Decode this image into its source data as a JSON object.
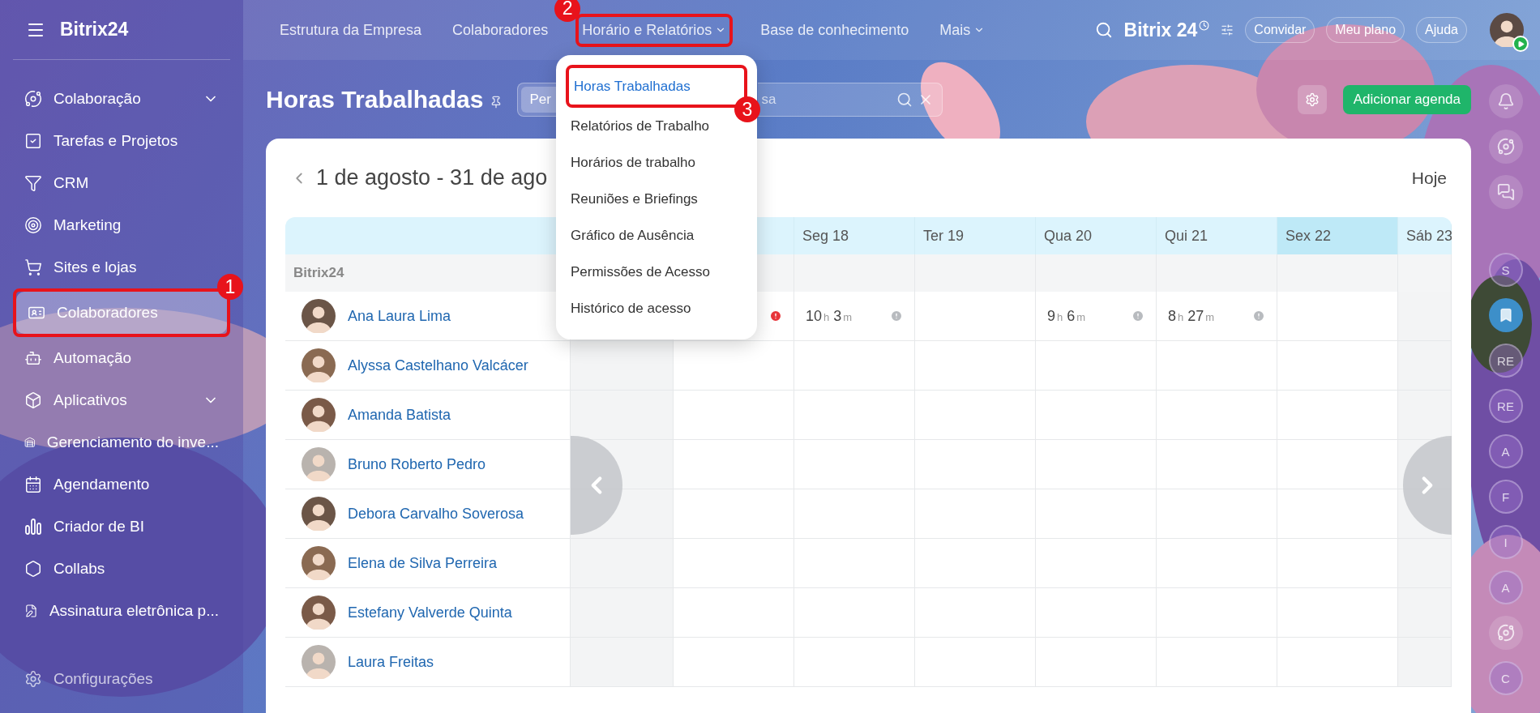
{
  "sidebar": {
    "logo": "Bitrix24",
    "items": [
      {
        "label": "Colaboração",
        "expandable": true,
        "selected": false
      },
      {
        "label": "Tarefas e Projetos",
        "expandable": false,
        "selected": false
      },
      {
        "label": "CRM",
        "expandable": false,
        "selected": false
      },
      {
        "label": "Marketing",
        "expandable": false,
        "selected": false
      },
      {
        "label": "Sites e lojas",
        "expandable": false,
        "selected": false
      },
      {
        "label": "Colaboradores",
        "expandable": false,
        "selected": true,
        "callout": "1"
      },
      {
        "label": "Automação",
        "expandable": false,
        "selected": false
      },
      {
        "label": "Aplicativos",
        "expandable": true,
        "selected": false
      },
      {
        "label": "Gerenciamento do inve...",
        "expandable": false,
        "selected": false
      },
      {
        "label": "Agendamento",
        "expandable": false,
        "selected": false
      },
      {
        "label": "Criador de BI",
        "expandable": false,
        "selected": false
      },
      {
        "label": "Collabs",
        "expandable": false,
        "selected": false
      },
      {
        "label": "Assinatura eletrônica p...",
        "expandable": false,
        "selected": false
      }
    ],
    "footer": "Configurações"
  },
  "topbar": {
    "nav": [
      {
        "label": "Estrutura da Empresa",
        "has_menu": false
      },
      {
        "label": "Colaboradores",
        "has_menu": false
      },
      {
        "label": "Horário e Relatórios",
        "has_menu": true,
        "callout": "2"
      },
      {
        "label": "Base de conhecimento",
        "has_menu": false
      },
      {
        "label": "Mais",
        "has_menu": true
      }
    ],
    "brand": "Bitrix 24",
    "buttons": [
      "Convidar",
      "Meu plano",
      "Ajuda"
    ]
  },
  "page": {
    "title": "Horas Trabalhadas",
    "filter_chip": "Per",
    "search_placeholder": "sa",
    "primary_button": "Adicionar agenda"
  },
  "dropdown": {
    "items": [
      {
        "label": "Horas Trabalhadas",
        "selected": true,
        "callout": "3"
      },
      {
        "label": "Relatórios de Trabalho",
        "selected": false
      },
      {
        "label": "Horários de trabalho",
        "selected": false
      },
      {
        "label": "Reuniões e Briefings",
        "selected": false
      },
      {
        "label": "Gráfico de Ausência",
        "selected": false
      },
      {
        "label": "Permissões de Acesso",
        "selected": false
      },
      {
        "label": "Histórico de acesso",
        "selected": false
      }
    ]
  },
  "calendar": {
    "period": "1 de agosto - 31 de ago",
    "today_button": "Hoje",
    "group": "Bitrix24",
    "columns": [
      {
        "kind": "weekend"
      },
      {
        "kind": "weekday"
      },
      {
        "label": "Seg 18",
        "kind": "weekday"
      },
      {
        "label": "Ter 19",
        "kind": "weekday"
      },
      {
        "label": "Qua 20",
        "kind": "weekday"
      },
      {
        "label": "Qui 21",
        "kind": "weekday"
      },
      {
        "label": "Sex 22",
        "kind": "today"
      },
      {
        "label": "Sáb 23",
        "kind": "weekend"
      }
    ],
    "rows": [
      {
        "name": "Ana Laura Lima",
        "cells": [
          null,
          {
            "color": "#e8353a"
          },
          {
            "time": [
              {
                "value": "10",
                "unit": "h"
              },
              {
                "value": "3",
                "unit": "m"
              }
            ],
            "color": "#b8bbbf"
          },
          null,
          {
            "time": [
              {
                "value": "9",
                "unit": "h"
              },
              {
                "value": "6",
                "unit": "m"
              }
            ],
            "color": "#b8bbbf"
          },
          {
            "time": [
              {
                "value": "8",
                "unit": "h"
              },
              {
                "value": "27",
                "unit": "m"
              }
            ],
            "color": "#b8bbbf"
          },
          null,
          null
        ]
      },
      {
        "name": "Alyssa Castelhano Valcácer"
      },
      {
        "name": "Amanda Batista"
      },
      {
        "name": "Bruno Roberto Pedro"
      },
      {
        "name": "Debora Carvalho Soverosa"
      },
      {
        "name": "Elena de Silva Perreira"
      },
      {
        "name": "Estefany Valverde Quinta"
      },
      {
        "name": "Laura Freitas"
      }
    ]
  },
  "rail": {
    "items": [
      {
        "kind": "bell"
      },
      {
        "kind": "orbit"
      },
      {
        "kind": "chat"
      },
      {
        "kind": "initials",
        "text": "S"
      },
      {
        "kind": "bookmark"
      },
      {
        "kind": "initials",
        "text": "RE"
      },
      {
        "kind": "initials",
        "text": "RE"
      },
      {
        "kind": "initials",
        "text": "A"
      },
      {
        "kind": "initials",
        "text": "F"
      },
      {
        "kind": "initials",
        "text": "I"
      },
      {
        "kind": "initials",
        "text": "A"
      },
      {
        "kind": "orbit"
      },
      {
        "kind": "initials",
        "text": "C"
      }
    ]
  }
}
